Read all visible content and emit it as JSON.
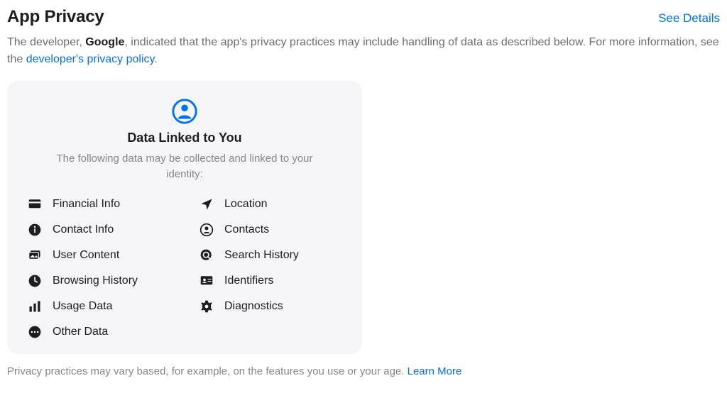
{
  "header": {
    "title": "App Privacy",
    "see_details": "See Details"
  },
  "intro": {
    "prefix": "The developer, ",
    "developer": "Google",
    "middle": ", indicated that the app's privacy practices may include handling of data as described below. For more information, see the ",
    "policy_link": "developer's privacy policy",
    "period": "."
  },
  "card": {
    "title": "Data Linked to You",
    "subtitle": "The following data may be collected and linked to your identity:"
  },
  "data_types": {
    "financial": "Financial Info",
    "location": "Location",
    "contact_info": "Contact Info",
    "contacts": "Contacts",
    "user_content": "User Content",
    "search_history": "Search History",
    "browsing_history": "Browsing History",
    "identifiers": "Identifiers",
    "usage_data": "Usage Data",
    "diagnostics": "Diagnostics",
    "other_data": "Other Data"
  },
  "footer": {
    "text": "Privacy practices may vary based, for example, on the features you use or your age. ",
    "learn_more": "Learn More"
  }
}
